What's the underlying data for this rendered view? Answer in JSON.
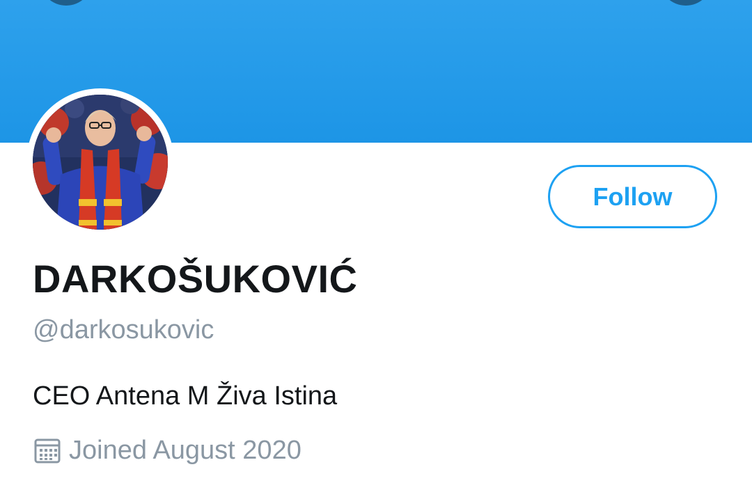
{
  "profile": {
    "display_name": "DARKOŠUKOVIĆ",
    "handle": "@darkosukovic",
    "bio": "CEO Antena M Živa Istina",
    "joined": "Joined August 2020",
    "follow_label": "Follow"
  },
  "colors": {
    "banner": "#1d95e6",
    "accent": "#1da1f2",
    "text_primary": "#14171a",
    "text_secondary": "#8a97a3"
  },
  "icons": {
    "joined": "calendar-icon"
  }
}
